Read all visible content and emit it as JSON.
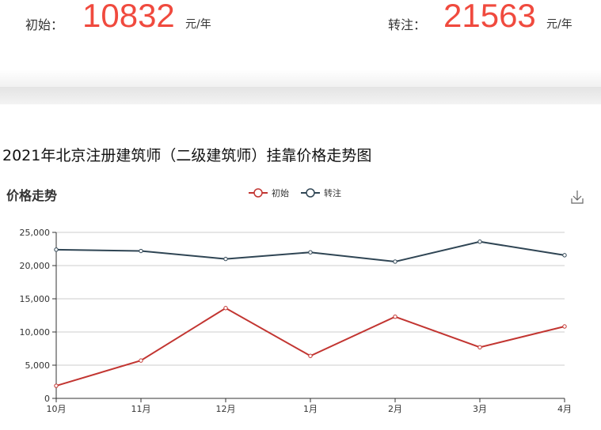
{
  "summary": {
    "initial_label": "初始：",
    "initial_value": "10832",
    "initial_unit": "元/年",
    "transfer_label": "转注：",
    "transfer_value": "21563",
    "transfer_unit": "元/年"
  },
  "page_title": "2021年北京注册建筑师（二级建筑师）挂靠价格走势图",
  "toolbar": {
    "download_icon": "download-icon"
  },
  "chart_data": {
    "type": "line",
    "title": "价格走势",
    "categories": [
      "10月",
      "11月",
      "12月",
      "1月",
      "2月",
      "3月",
      "4月"
    ],
    "series": [
      {
        "name": "初始",
        "color": "#c23531",
        "values": [
          1900,
          5700,
          13600,
          6400,
          12300,
          7700,
          10832
        ]
      },
      {
        "name": "转注",
        "color": "#2f4554",
        "values": [
          22400,
          22200,
          21000,
          22000,
          20600,
          23600,
          21563
        ]
      }
    ],
    "ylim": [
      0,
      25000
    ],
    "yticks": [
      "0",
      "5,000",
      "10,000",
      "15,000",
      "20,000",
      "25,000"
    ],
    "grid": true,
    "legend": "top-center"
  }
}
